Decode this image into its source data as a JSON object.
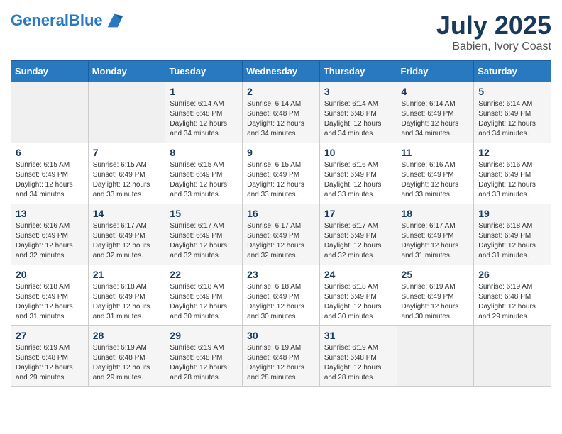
{
  "header": {
    "logo_line1": "General",
    "logo_line2": "Blue",
    "month": "July 2025",
    "location": "Babien, Ivory Coast"
  },
  "weekdays": [
    "Sunday",
    "Monday",
    "Tuesday",
    "Wednesday",
    "Thursday",
    "Friday",
    "Saturday"
  ],
  "weeks": [
    [
      {
        "day": "",
        "info": ""
      },
      {
        "day": "",
        "info": ""
      },
      {
        "day": "1",
        "info": "Sunrise: 6:14 AM\nSunset: 6:48 PM\nDaylight: 12 hours and 34 minutes."
      },
      {
        "day": "2",
        "info": "Sunrise: 6:14 AM\nSunset: 6:48 PM\nDaylight: 12 hours and 34 minutes."
      },
      {
        "day": "3",
        "info": "Sunrise: 6:14 AM\nSunset: 6:48 PM\nDaylight: 12 hours and 34 minutes."
      },
      {
        "day": "4",
        "info": "Sunrise: 6:14 AM\nSunset: 6:49 PM\nDaylight: 12 hours and 34 minutes."
      },
      {
        "day": "5",
        "info": "Sunrise: 6:14 AM\nSunset: 6:49 PM\nDaylight: 12 hours and 34 minutes."
      }
    ],
    [
      {
        "day": "6",
        "info": "Sunrise: 6:15 AM\nSunset: 6:49 PM\nDaylight: 12 hours and 34 minutes."
      },
      {
        "day": "7",
        "info": "Sunrise: 6:15 AM\nSunset: 6:49 PM\nDaylight: 12 hours and 33 minutes."
      },
      {
        "day": "8",
        "info": "Sunrise: 6:15 AM\nSunset: 6:49 PM\nDaylight: 12 hours and 33 minutes."
      },
      {
        "day": "9",
        "info": "Sunrise: 6:15 AM\nSunset: 6:49 PM\nDaylight: 12 hours and 33 minutes."
      },
      {
        "day": "10",
        "info": "Sunrise: 6:16 AM\nSunset: 6:49 PM\nDaylight: 12 hours and 33 minutes."
      },
      {
        "day": "11",
        "info": "Sunrise: 6:16 AM\nSunset: 6:49 PM\nDaylight: 12 hours and 33 minutes."
      },
      {
        "day": "12",
        "info": "Sunrise: 6:16 AM\nSunset: 6:49 PM\nDaylight: 12 hours and 33 minutes."
      }
    ],
    [
      {
        "day": "13",
        "info": "Sunrise: 6:16 AM\nSunset: 6:49 PM\nDaylight: 12 hours and 32 minutes."
      },
      {
        "day": "14",
        "info": "Sunrise: 6:17 AM\nSunset: 6:49 PM\nDaylight: 12 hours and 32 minutes."
      },
      {
        "day": "15",
        "info": "Sunrise: 6:17 AM\nSunset: 6:49 PM\nDaylight: 12 hours and 32 minutes."
      },
      {
        "day": "16",
        "info": "Sunrise: 6:17 AM\nSunset: 6:49 PM\nDaylight: 12 hours and 32 minutes."
      },
      {
        "day": "17",
        "info": "Sunrise: 6:17 AM\nSunset: 6:49 PM\nDaylight: 12 hours and 32 minutes."
      },
      {
        "day": "18",
        "info": "Sunrise: 6:17 AM\nSunset: 6:49 PM\nDaylight: 12 hours and 31 minutes."
      },
      {
        "day": "19",
        "info": "Sunrise: 6:18 AM\nSunset: 6:49 PM\nDaylight: 12 hours and 31 minutes."
      }
    ],
    [
      {
        "day": "20",
        "info": "Sunrise: 6:18 AM\nSunset: 6:49 PM\nDaylight: 12 hours and 31 minutes."
      },
      {
        "day": "21",
        "info": "Sunrise: 6:18 AM\nSunset: 6:49 PM\nDaylight: 12 hours and 31 minutes."
      },
      {
        "day": "22",
        "info": "Sunrise: 6:18 AM\nSunset: 6:49 PM\nDaylight: 12 hours and 30 minutes."
      },
      {
        "day": "23",
        "info": "Sunrise: 6:18 AM\nSunset: 6:49 PM\nDaylight: 12 hours and 30 minutes."
      },
      {
        "day": "24",
        "info": "Sunrise: 6:18 AM\nSunset: 6:49 PM\nDaylight: 12 hours and 30 minutes."
      },
      {
        "day": "25",
        "info": "Sunrise: 6:19 AM\nSunset: 6:49 PM\nDaylight: 12 hours and 30 minutes."
      },
      {
        "day": "26",
        "info": "Sunrise: 6:19 AM\nSunset: 6:48 PM\nDaylight: 12 hours and 29 minutes."
      }
    ],
    [
      {
        "day": "27",
        "info": "Sunrise: 6:19 AM\nSunset: 6:48 PM\nDaylight: 12 hours and 29 minutes."
      },
      {
        "day": "28",
        "info": "Sunrise: 6:19 AM\nSunset: 6:48 PM\nDaylight: 12 hours and 29 minutes."
      },
      {
        "day": "29",
        "info": "Sunrise: 6:19 AM\nSunset: 6:48 PM\nDaylight: 12 hours and 28 minutes."
      },
      {
        "day": "30",
        "info": "Sunrise: 6:19 AM\nSunset: 6:48 PM\nDaylight: 12 hours and 28 minutes."
      },
      {
        "day": "31",
        "info": "Sunrise: 6:19 AM\nSunset: 6:48 PM\nDaylight: 12 hours and 28 minutes."
      },
      {
        "day": "",
        "info": ""
      },
      {
        "day": "",
        "info": ""
      }
    ]
  ]
}
